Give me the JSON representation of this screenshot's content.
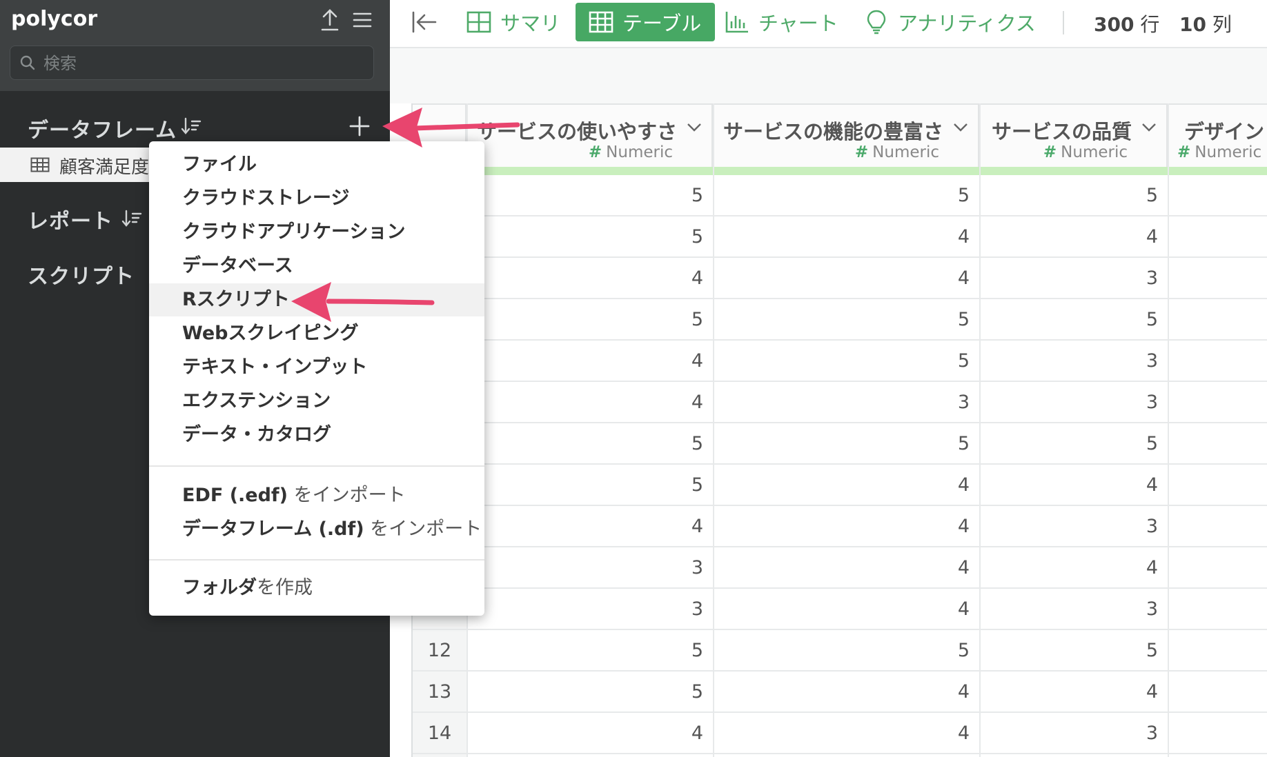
{
  "app": {
    "title": "polycor"
  },
  "search": {
    "placeholder": "検索"
  },
  "sidebar": {
    "dataframes_label": "データフレーム",
    "dataframe_item": "顧客満足度",
    "reports_label": "レポート",
    "scripts_label": "スクリプト"
  },
  "toolbar": {
    "tabs": [
      {
        "label": "サマリ",
        "icon": "summary-grid-icon"
      },
      {
        "label": "テーブル",
        "icon": "table-icon",
        "active": true
      },
      {
        "label": "チャート",
        "icon": "bar-chart-icon"
      },
      {
        "label": "アナリティクス",
        "icon": "lightbulb-icon"
      }
    ],
    "rows_count": "300",
    "rows_unit": "行",
    "cols_count": "10",
    "cols_unit": "列"
  },
  "table": {
    "columns": [
      {
        "name": "サービスの使いやすさ",
        "type": "Numeric"
      },
      {
        "name": "サービスの機能の豊富さ",
        "type": "Numeric"
      },
      {
        "name": "サービスの品質",
        "type": "Numeric"
      },
      {
        "name": "デザイン",
        "type": "Numeric"
      }
    ],
    "visible_row_numbers": [
      "12",
      "13",
      "14"
    ],
    "rows": [
      [
        "5",
        "5",
        "5"
      ],
      [
        "5",
        "4",
        "4"
      ],
      [
        "4",
        "4",
        "3"
      ],
      [
        "5",
        "5",
        "5"
      ],
      [
        "4",
        "5",
        "3"
      ],
      [
        "4",
        "3",
        "3"
      ],
      [
        "5",
        "5",
        "5"
      ],
      [
        "5",
        "4",
        "4"
      ],
      [
        "4",
        "4",
        "3"
      ],
      [
        "3",
        "4",
        "4"
      ],
      [
        "3",
        "4",
        "3"
      ],
      [
        "5",
        "5",
        "5"
      ],
      [
        "5",
        "4",
        "4"
      ],
      [
        "4",
        "4",
        "3"
      ]
    ]
  },
  "menu": {
    "items": [
      "ファイル",
      "クラウドストレージ",
      "クラウドアプリケーション",
      "データベース",
      "Rスクリプト",
      "Webスクレイピング",
      "テキスト・インプット",
      "エクステンション",
      "データ・カタログ"
    ],
    "import_edf_bold": "EDF (.edf)",
    "import_edf_light": " をインポート",
    "import_df_bold": "データフレーム (.df)",
    "import_df_light": " をインポート",
    "folder_bold": "フォルダ",
    "folder_light": "を作成"
  },
  "colors": {
    "accent_green": "#47a864",
    "sidebar_bg": "#2b2d2e",
    "arrow_pink": "#e8456e"
  }
}
